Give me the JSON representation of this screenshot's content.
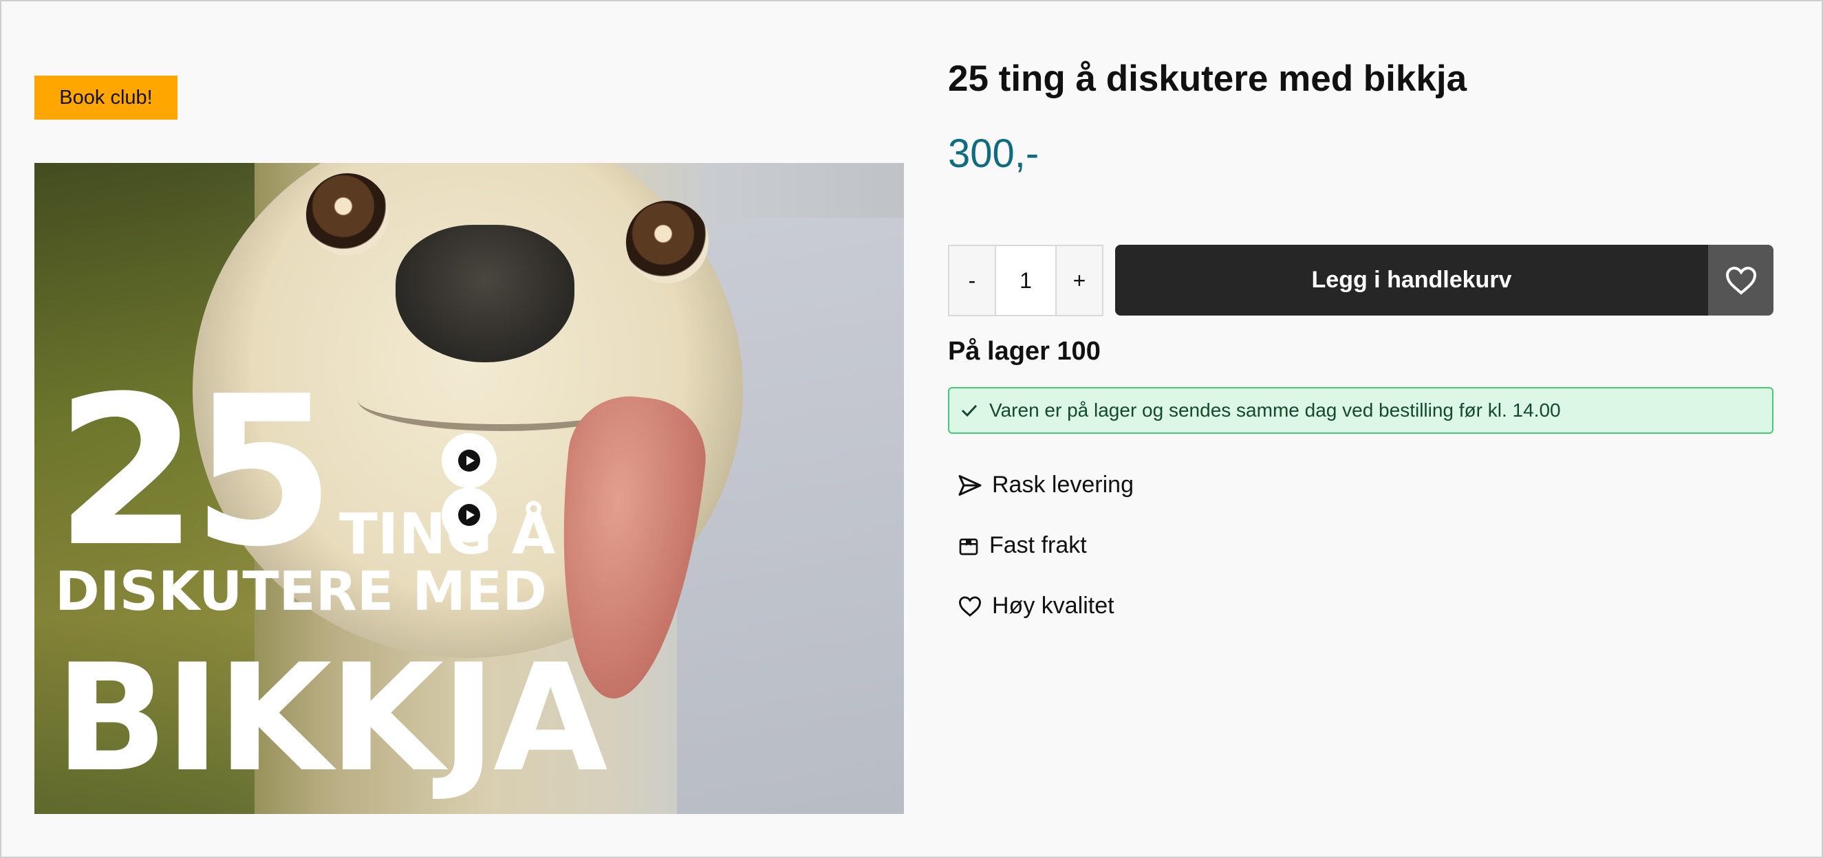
{
  "badge": {
    "label": "Book club!"
  },
  "product": {
    "title": "25 ting å diskutere med bikkja",
    "price": "300,-",
    "cover_text": {
      "line1": "25",
      "line2": "TING Å",
      "line3": "DISKUTERE MED",
      "line4": "BIKKJA"
    }
  },
  "quantity": {
    "decrement": "-",
    "value": "1",
    "increment": "+"
  },
  "cart": {
    "add_label": "Legg i handlekurv"
  },
  "stock": {
    "label": "På lager 100"
  },
  "notice": {
    "text": "Varen er på lager og sendes samme dag ved bestilling før kl. 14.00"
  },
  "features": [
    {
      "icon": "send-icon",
      "label": "Rask levering"
    },
    {
      "icon": "box-icon",
      "label": "Fast frakt"
    },
    {
      "icon": "heart-icon",
      "label": "Høy kvalitet"
    }
  ],
  "colors": {
    "badge": "#ffa600",
    "price": "#0e6b80",
    "button": "#262626",
    "wishlist": "#555555",
    "notice_bg": "#dcf7e6",
    "notice_border": "#48c97a"
  }
}
